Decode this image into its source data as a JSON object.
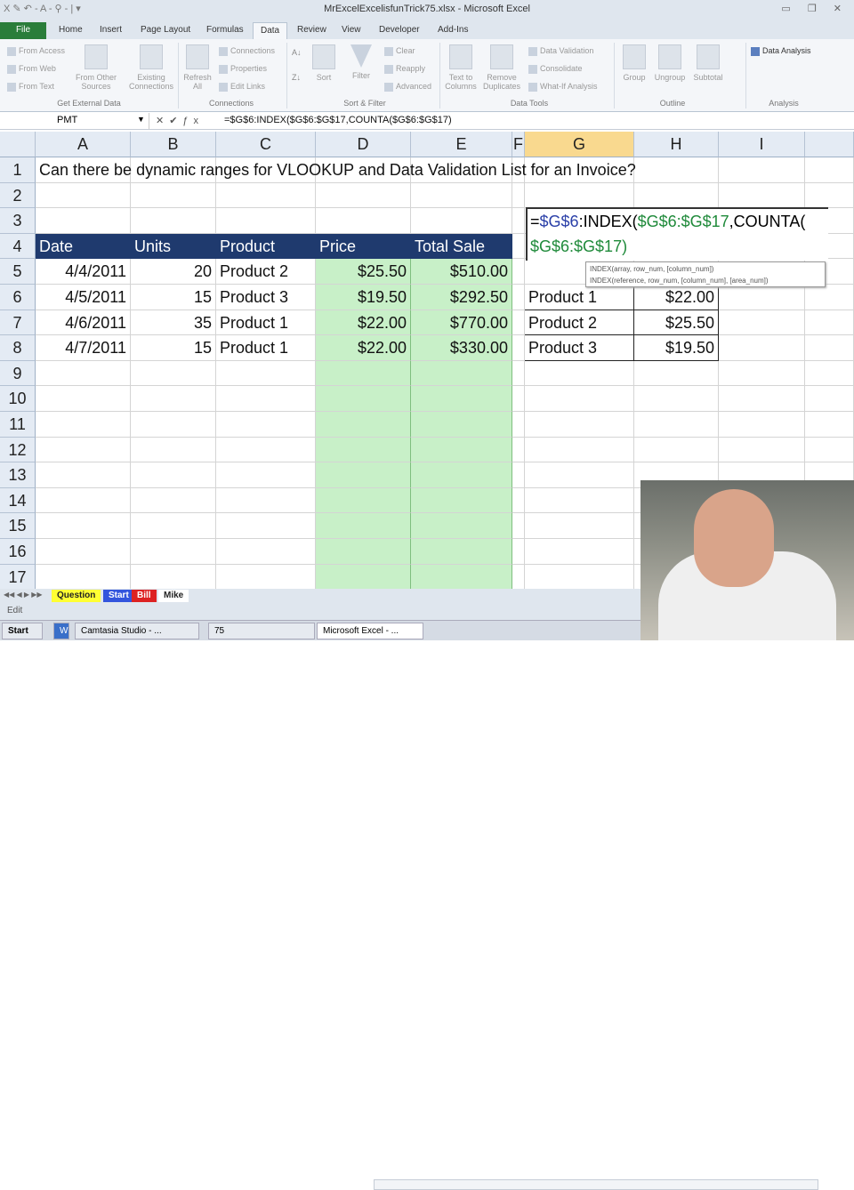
{
  "window": {
    "title": "MrExcelExcelisfunTrick75.xlsx - Microsoft Excel",
    "qat": "X  ✎  ↶ - A - ⚲  - | ▾",
    "controls": "▭ ❐ ✕"
  },
  "tabs": [
    "File",
    "Home",
    "Insert",
    "Page Layout",
    "Formulas",
    "Data",
    "Review",
    "View",
    "Developer",
    "Add-Ins"
  ],
  "ribbon": {
    "get_external": {
      "items": [
        "From Access",
        "From Web",
        "From Text"
      ],
      "other": "From Other Sources",
      "existing": "Existing Connections",
      "label": "Get External Data"
    },
    "connections": {
      "refresh": "Refresh All",
      "items": [
        "Connections",
        "Properties",
        "Edit Links"
      ],
      "label": "Connections"
    },
    "sort_filter": {
      "sort": "Sort",
      "filter": "Filter",
      "items": [
        "Clear",
        "Reapply",
        "Advanced"
      ],
      "label": "Sort & Filter"
    },
    "data_tools": {
      "text_to_columns": "Text to Columns",
      "remove_dup": "Remove Duplicates",
      "items": [
        "Data Validation",
        "Consolidate",
        "What-If Analysis"
      ],
      "label": "Data Tools"
    },
    "outline": {
      "items": [
        "Group",
        "Ungroup",
        "Subtotal"
      ],
      "label": "Outline"
    },
    "analysis": {
      "item": "Data Analysis",
      "label": "Analysis"
    }
  },
  "formula_bar": {
    "name_box": "PMT",
    "formula": "=$G$6:INDEX($G$6:$G$17,COUNTA($G$6:$G$17)"
  },
  "columns": [
    "A",
    "B",
    "C",
    "D",
    "E",
    "F",
    "G",
    "H",
    "I"
  ],
  "rows": [
    "1",
    "2",
    "3",
    "4",
    "5",
    "6",
    "7",
    "8",
    "9",
    "10",
    "11",
    "12",
    "13",
    "14",
    "15",
    "16",
    "17"
  ],
  "title_cell": "Can there be dynamic ranges for VLOOKUP and Data Validation List for an Invoice?",
  "table": {
    "headers": [
      "Date",
      "Units",
      "Product",
      "Price",
      "Total Sale"
    ],
    "rows": [
      [
        "4/4/2011",
        "20",
        "Product 2",
        "$25.50",
        "$510.00"
      ],
      [
        "4/5/2011",
        "15",
        "Product 3",
        "$19.50",
        "$292.50"
      ],
      [
        "4/6/2011",
        "35",
        "Product 1",
        "$22.00",
        "$770.00"
      ],
      [
        "4/7/2011",
        "15",
        "Product 1",
        "$22.00",
        "$330.00"
      ]
    ]
  },
  "lookup": [
    [
      "Product 1",
      "$22.00"
    ],
    [
      "Product 2",
      "$25.50"
    ],
    [
      "Product 3",
      "$19.50"
    ]
  ],
  "edit_cell": {
    "p1": "=",
    "p2": "$G$6",
    "p3": ":INDEX(",
    "p4": "$G$6:$G$17",
    "p5": ",COUNTA(",
    "p6": "$G$6:$G$17)"
  },
  "tooltip": [
    "INDEX(array, row_num, [column_num])",
    "INDEX(reference, row_num, [column_num], [area_num])"
  ],
  "sheet_tabs": [
    {
      "name": "Question",
      "color": "#ffff33"
    },
    {
      "name": "Start",
      "color": "#3355dd"
    },
    {
      "name": "Bill",
      "color": "#dd2222"
    },
    {
      "name": "Mike",
      "color": "#ffffff"
    }
  ],
  "status": "Edit",
  "taskbar": [
    "Start",
    "Camtasia Studio - ...",
    "75",
    "Microsoft Excel - ..."
  ]
}
